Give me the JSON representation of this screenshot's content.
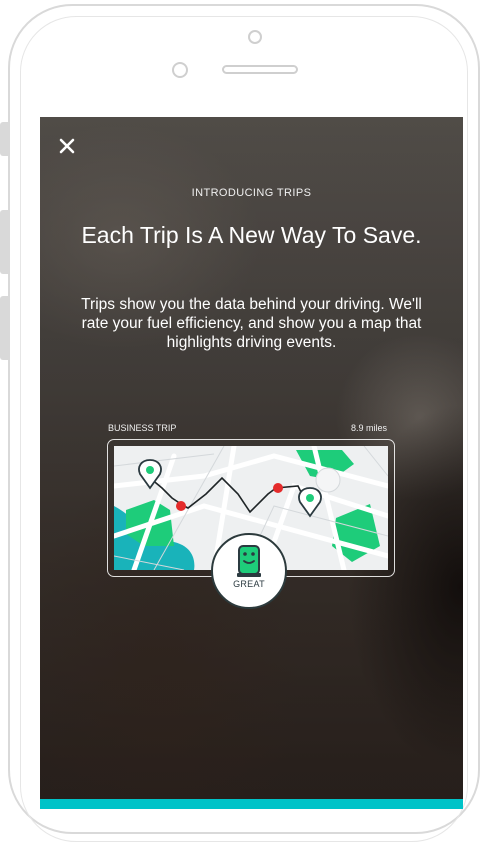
{
  "modal": {
    "eyebrow": "INTRODUCING TRIPS",
    "title": "Each Trip Is A New Way To Save.",
    "description": "Trips show you the data behind your driving. We'll rate your fuel efficiency, and show you a map that highlights driving events."
  },
  "trip_card": {
    "label": "BUSINESS TRIP",
    "distance": "8.9 miles",
    "rating": "GREAT"
  },
  "icons": {
    "close": "close-icon",
    "rating": "fuel-pump-icon",
    "start": "map-pin-icon",
    "end": "map-pin-icon",
    "event": "driving-event-marker"
  },
  "colors": {
    "accent": "#00c3c8",
    "map_green": "#1ecc7a",
    "map_water": "#19b3ba",
    "event_red": "#e42b2b",
    "route": "#1f2527"
  }
}
